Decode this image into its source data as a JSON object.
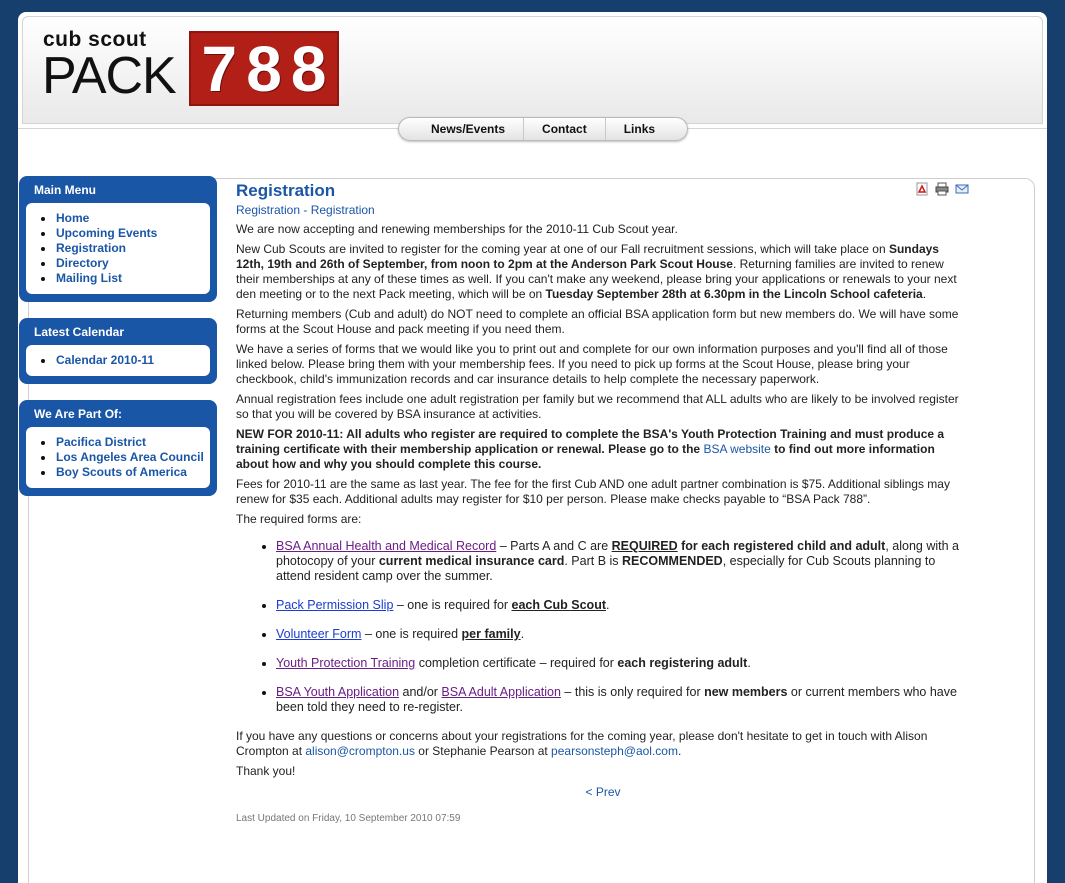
{
  "logo": {
    "small": "cub scout",
    "big": "PACK",
    "digits": [
      "7",
      "8",
      "8"
    ]
  },
  "topnav": [
    "News/Events",
    "Contact",
    "Links"
  ],
  "sidebar": {
    "main_menu": {
      "title": "Main Menu",
      "items": [
        "Home",
        "Upcoming Events",
        "Registration",
        "Directory",
        "Mailing List"
      ]
    },
    "latest_calendar": {
      "title": "Latest Calendar",
      "items": [
        "Calendar 2010-11"
      ]
    },
    "we_are_part_of": {
      "title": "We Are Part Of:",
      "items": [
        "Pacifica District",
        "Los Angeles Area Council",
        "Boy Scouts of America"
      ]
    }
  },
  "article": {
    "title": "Registration",
    "breadcrumb": {
      "a": "Registration",
      "sep": " - ",
      "b": "Registration"
    },
    "p1": "We are now accepting and renewing memberships for the 2010-11 Cub Scout year.",
    "p2": {
      "t1": "New Cub Scouts are invited to register for the coming year at one of our Fall recruitment sessions, which will take place on ",
      "b1": "Sundays 12th, 19th and 26th of September, from noon to 2pm at the Anderson Park Scout House",
      "t2": ". Returning families are invited to renew their memberships at any of these times as well.  If you can't make any weekend, please bring your applications or renewals to your next den meeting or to the next Pack meeting, which will be on ",
      "b2": "Tuesday September 28th at 6.30pm in the Lincoln School cafeteria",
      "t3": "."
    },
    "p3": "Returning members (Cub and adult) do NOT need to complete an official BSA application form but new members do. We will have some forms at the Scout House and pack meeting if you need them.",
    "p4": "We have a series of forms that we would like you to print out and complete for our own information purposes and you'll find all of those linked below. Please bring them with your membership fees. If you need to pick up forms at the Scout House, please bring your checkbook, child's immunization records and car insurance details to help complete the necessary paperwork.",
    "p5": "Annual registration fees include one adult registration per family but we recommend that ALL adults who are likely to be involved register so that you will be covered by BSA insurance at activities.",
    "p6": {
      "b1": "NEW FOR 2010-11: All adults who register are required to complete the BSA's Youth Protection Training and must produce a training certificate with their membership application or renewal.  Please go to the ",
      "link": "BSA website",
      "b2": " to find out more information about how and why you should complete this course."
    },
    "p7": "Fees for 2010-11 are the same as last year. The fee for the first Cub AND one adult partner combination is $75. Additional siblings may renew for $35 each. Additional adults may register for $10 per person. Please make checks payable to “BSA Pack 788”.",
    "p8": "The required forms are:",
    "forms": {
      "f1": {
        "link": "BSA Annual Health and Medical Record",
        "t1": " – Parts A and C are ",
        "b1": "REQUIRED",
        "b2": " for each registered child and adult",
        "t2": ", along with a photocopy of your ",
        "b3": "current medical insurance card",
        "t3": ".  Part B is ",
        "b4": "RECOMMENDED",
        "t4": ", especially for Cub Scouts planning to attend resident camp over the summer."
      },
      "f2": {
        "link": "Pack Permission Slip",
        "t1": " – one is required for ",
        "b1": "each Cub Scout",
        "t2": "."
      },
      "f3": {
        "link": "Volunteer Form",
        "t1": " – one is required ",
        "b1": "per family",
        "t2": "."
      },
      "f4": {
        "link": "Youth Protection Training",
        "t1": " completion certificate – required for ",
        "b1": "each registering adult",
        "t2": "."
      },
      "f5": {
        "link1": "BSA Youth Application",
        "t1": " and/or ",
        "link2": "BSA Adult Application",
        "t2": " – this is only required for ",
        "b1": "new members",
        "t3": " or  current members who have been told they need to re-register."
      }
    },
    "p9": {
      "t1": "If you have any questions or concerns about your registrations for the coming year, please don't hesitate to get in touch with Alison Crompton at ",
      "email1": "alison@crompton.us",
      "t2": " or Stephanie Pearson at ",
      "email2": "pearsonsteph@aol.com",
      "t3": "."
    },
    "p10": "Thank you!",
    "prev": "< Prev",
    "updated": "Last Updated on Friday, 10 September 2010 07:59"
  },
  "icons": [
    "pdf-icon",
    "print-icon",
    "email-icon"
  ]
}
